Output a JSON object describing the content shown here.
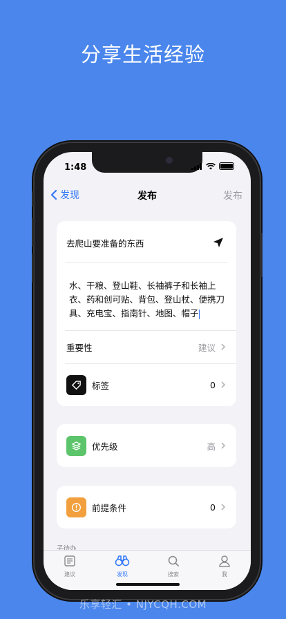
{
  "promo": {
    "headline": "分享生活经验"
  },
  "status_bar": {
    "time": "1:48"
  },
  "nav": {
    "back_label": "发现",
    "title": "发布",
    "action_label": "发布"
  },
  "post": {
    "title": "去爬山要准备的东西",
    "body": "水、干粮、登山鞋、长袖裤子和长袖上衣、药和创可贴、背包、登山杖、便携刀具、充电宝、指南针、地图、帽子"
  },
  "rows": {
    "importance": {
      "label": "重要性",
      "value": "建议"
    },
    "tags": {
      "label": "标签",
      "value": "0"
    },
    "priority": {
      "label": "优先级",
      "value": "高"
    },
    "prerequisite": {
      "label": "前提条件",
      "value": "0"
    }
  },
  "section": {
    "subtasks_label": "子待办"
  },
  "tabbar": [
    {
      "label": "建议",
      "icon": "document-icon",
      "active": false
    },
    {
      "label": "发现",
      "icon": "binoculars-icon",
      "active": true
    },
    {
      "label": "搜索",
      "icon": "search-icon",
      "active": false
    },
    {
      "label": "我",
      "icon": "person-icon",
      "active": false
    }
  ],
  "colors": {
    "background": "#4a86ec",
    "accent": "#3478f6",
    "tag_icon_bg": "#111111",
    "priority_icon_bg": "#5cc46a",
    "prerequisite_icon_bg": "#f2a03d"
  },
  "watermark": "乐享轻汇 • NJYCQH.COM"
}
